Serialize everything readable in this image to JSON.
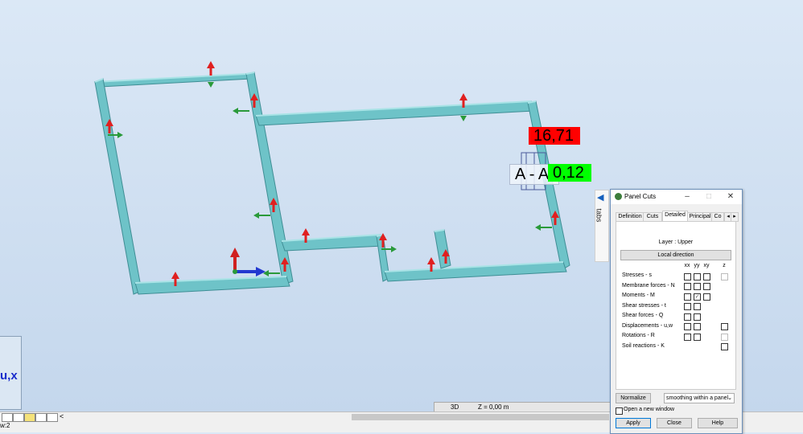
{
  "viewport": {
    "result_value_red": "16,71",
    "cut_name": "A - A",
    "result_value_green": "0,12",
    "axis_stub_label": "u,x",
    "tabs_strip_label": "tabs",
    "status": {
      "view_mode": "3D",
      "z_level": "Z = 0,00 m"
    },
    "status_line": "w:2"
  },
  "dialog": {
    "title": "Panel Cuts",
    "tabs": [
      "Definition",
      "Cuts",
      "Detailed",
      "Principal",
      "Co"
    ],
    "active_tab": "Detailed",
    "layer_label": "Layer : Upper",
    "local_direction_button": "Local direction",
    "columns": [
      "xx",
      "yy",
      "xy",
      "z"
    ],
    "rows": [
      {
        "label": "Stresses - s",
        "xx": false,
        "yy": false,
        "xy": false,
        "z": "disabled"
      },
      {
        "label": "Membrane forces - N",
        "xx": false,
        "yy": false,
        "xy": false
      },
      {
        "label": "Moments - M",
        "xx": false,
        "yy": true,
        "xy": false
      },
      {
        "label": "Shear stresses - t",
        "xx": false,
        "yy": false
      },
      {
        "label": "Shear forces - Q",
        "xx": false,
        "yy": false
      },
      {
        "label": "Displacements - u,w",
        "xx": false,
        "yy": false,
        "z": false
      },
      {
        "label": "Rotations - R",
        "xx": false,
        "yy": false,
        "z": "disabled"
      },
      {
        "label": "Soil reactions - K",
        "z": false
      }
    ],
    "normalize_button": "Normalize",
    "smoothing_select": "smoothing within a panel",
    "open_new_window_label": "Open a new window",
    "open_new_window_checked": false,
    "apply_button": "Apply",
    "close_button": "Close",
    "help_button": "Help"
  },
  "colors": {
    "beam": "#6ec3c8",
    "red_arrow": "#e02020",
    "green_arrow": "#2a9a3a",
    "dialog_border": "#6b8fba"
  }
}
